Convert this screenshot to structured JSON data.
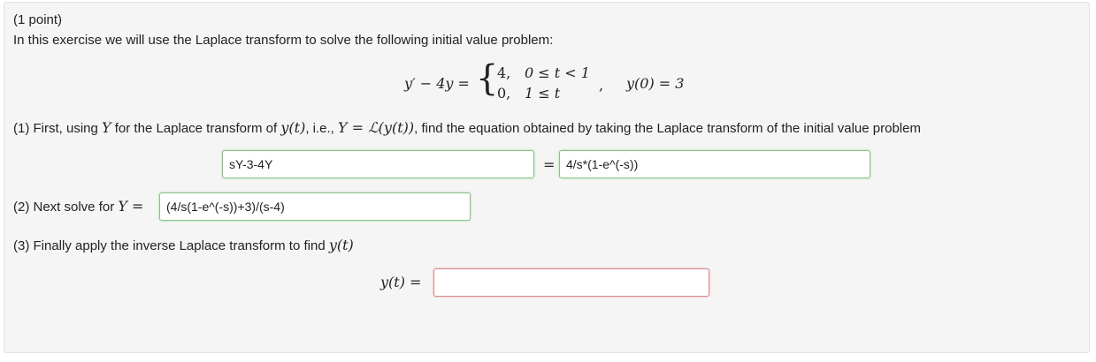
{
  "problem": {
    "points": "(1 point)",
    "intro": "In this exercise we will use the Laplace transform to solve the following initial value problem:"
  },
  "equation": {
    "lhs": "y′ − 4y =",
    "case1_value": "4,",
    "case1_cond": "0 ≤ t < 1",
    "case2_value": "0,",
    "case2_cond": "1 ≤ t",
    "comma": ",",
    "initial": "y(0) = 3"
  },
  "part1": {
    "prefix": "(1) First, using ",
    "Y": "Y",
    "mid1": " for the Laplace transform of ",
    "yt": "y(t)",
    "mid2": ", i.e., ",
    "def": "Y = ℒ(y(t))",
    "suffix": ", find the equation obtained by taking the Laplace transform of the initial value problem",
    "lhs_value": "sY-3-4Y",
    "equals": "=",
    "rhs_value": "4/s*(1-e^(-s))"
  },
  "part2": {
    "prefix": "(2) Next solve for ",
    "Y_eq": "Y =",
    "value": "(4/s(1-e^(-s))+3)/(s-4)"
  },
  "part3": {
    "prefix": "(3) Finally apply the inverse Laplace transform to find ",
    "yt": "y(t)",
    "label": "y(t) =",
    "value": ""
  }
}
